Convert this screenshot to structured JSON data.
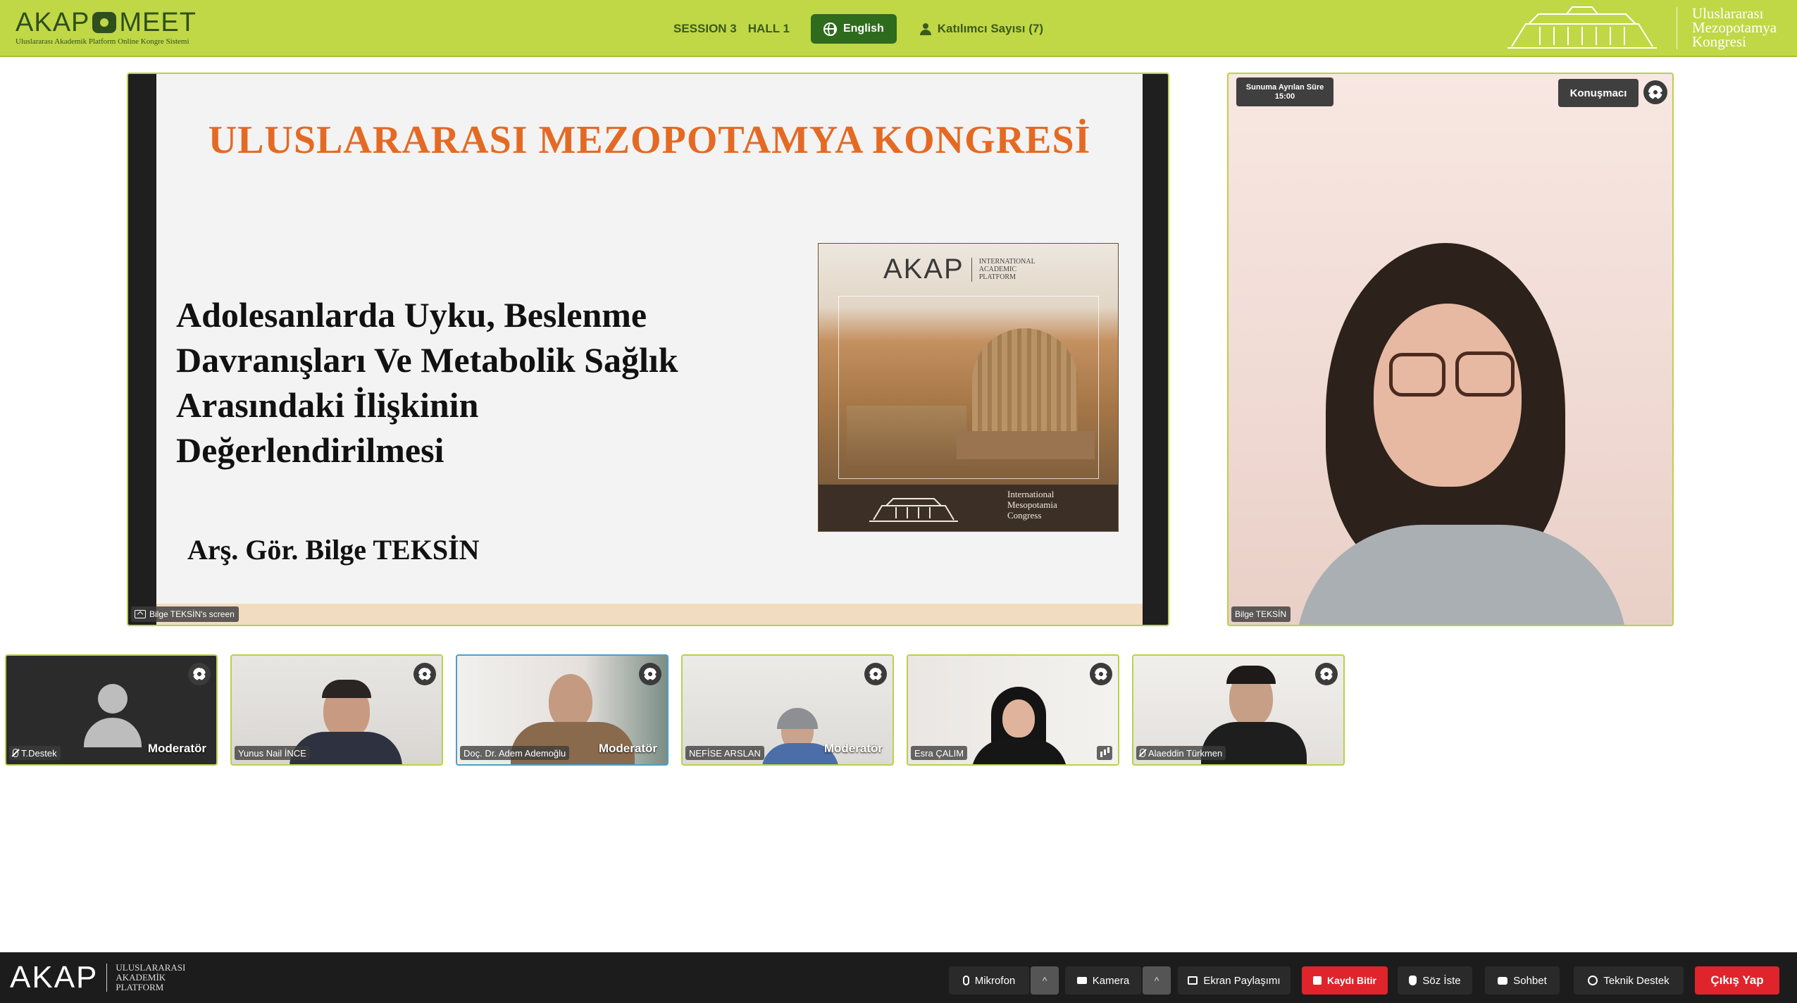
{
  "header": {
    "logo_left": "AKAP",
    "logo_right": "MEET",
    "logo_subtitle": "Uluslararası Akademik Platform Online Kongre Sistemi",
    "session": "SESSION 3",
    "hall": "HALL 1",
    "language_button": "English",
    "participants_label": "Katılımcı Sayısı (7)",
    "congress_name_line1": "Uluslararası",
    "congress_name_line2": "Mezopotamya",
    "congress_name_line3": "Kongresi",
    "bg_color": "#c0d846"
  },
  "slide": {
    "title": "ULUSLARARASI MEZOPOTAMYA KONGRESİ",
    "subject_line1": "Adolesanlarda Uyku, Beslenme",
    "subject_line2": "Davranışları Ve Metabolik Sağlık",
    "subject_line3": "Arasındaki İlişkinin",
    "subject_line4": "Değerlendirilmesi",
    "author": "Arş. Gör. Bilge TEKSİN",
    "book_brand": "AKAP",
    "book_brand_sub1": "INTERNATIONAL",
    "book_brand_sub2": "ACADEMIC",
    "book_brand_sub3": "PLATFORM",
    "book_footer1": "International",
    "book_footer2": "Mesopotamia",
    "book_footer3": "Congress",
    "title_color": "#e46a24"
  },
  "screen_share": {
    "label": "Bilge TEKSİN's screen"
  },
  "speaker": {
    "timer_label": "Sunuma Ayrılan Süre",
    "timer_value": "15:00",
    "role": "Konuşmacı",
    "name": "Bilge TEKSİN"
  },
  "participants": [
    {
      "name": "T.Destek",
      "role": "Moderatör",
      "muted": true
    },
    {
      "name": "Yunus Nail İNCE",
      "role": ""
    },
    {
      "name": "Doç. Dr. Adem Ademoğlu",
      "role": "Moderatör"
    },
    {
      "name": "NEFİSE ARSLAN",
      "role": "Moderatör"
    },
    {
      "name": "Esra ÇALIM",
      "role": ""
    },
    {
      "name": "Alaeddin Türkmen",
      "role": "",
      "muted": true
    }
  ],
  "footer": {
    "logo": "AKAP",
    "logo_sub1": "ULUSLARARASI",
    "logo_sub2": "AKADEMİK",
    "logo_sub3": "PLATFORM",
    "mic": "Mikrofon",
    "camera": "Kamera",
    "screen_share": "Ekran Paylaşımı",
    "stop_recording": "Kaydı Bitir",
    "raise_hand": "Söz İste",
    "chat": "Sohbet",
    "support": "Teknik Destek",
    "exit": "Çıkış Yap",
    "caret": "^"
  }
}
